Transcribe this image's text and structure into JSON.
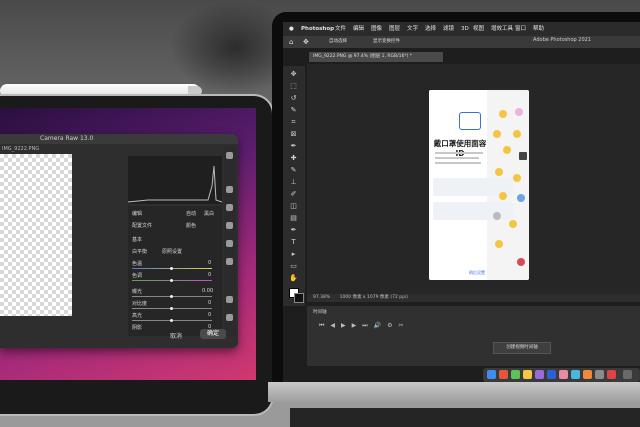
{
  "ipad": {
    "camera_raw_title": "Camera Raw 13.0",
    "filename": "IMG_9222.PNG",
    "panel": {
      "edit": "编辑",
      "auto": "自动",
      "bw": "黑白",
      "profile": "配置文件",
      "profile_value": "颜色",
      "basic": "基本",
      "white_balance": "白平衡",
      "wb_value": "原照设置",
      "temp": "色温",
      "tint": "色调",
      "exposure": "曝光",
      "contrast": "对比度",
      "highlights": "高光",
      "shadows": "阴影",
      "temp_value": "0",
      "tint_value": "0",
      "exposure_value": "0.00",
      "contrast_value": "0",
      "highlights_value": "0",
      "shadows_value": "0"
    },
    "cancel": "取消",
    "ok": "确定"
  },
  "mac": {
    "menu": [
      "Photoshop",
      "文件",
      "编辑",
      "图像",
      "图层",
      "文字",
      "选择",
      "滤镜",
      "3D",
      "视图",
      "增效工具",
      "窗口",
      "帮助"
    ],
    "options_auto_select": "自动选择",
    "options_show_transform": "显示变换控件",
    "app_title": "Adobe Photoshop 2021",
    "doc_tab": "IMG_9222.PNG @ 97.4% (图层 1, RGB/16*) *",
    "phone": {
      "title": "戴口罩使用面容 ID",
      "link": "稍后设置"
    },
    "status_zoom": "97.38%",
    "status_size": "1000 像素 x 1079 像素 (72 ppi)",
    "timeline_label": "时间轴",
    "timeline_button": "创建视频时间轴"
  }
}
